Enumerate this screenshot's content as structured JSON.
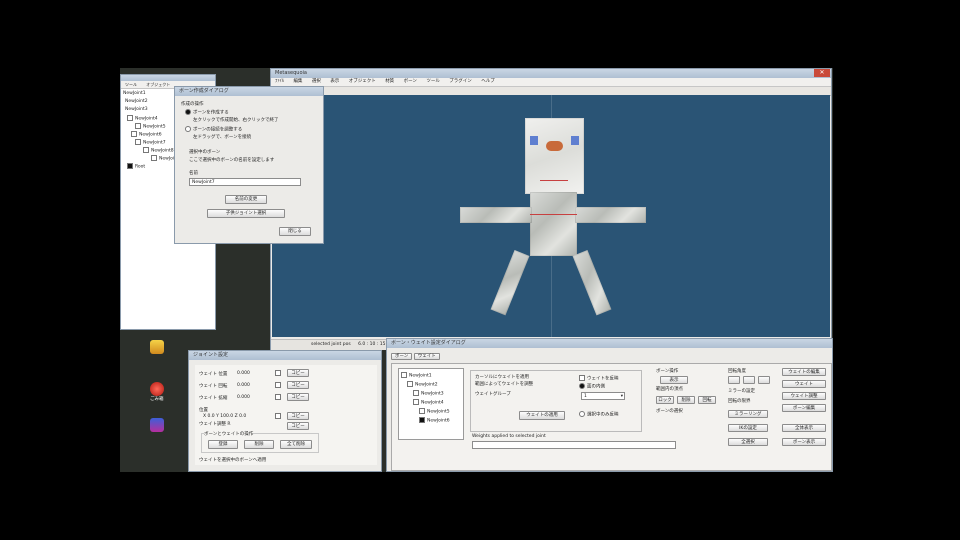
{
  "editor": {
    "title": "Metasequoia",
    "menu": [
      "ﾌｧｲﾙ",
      "編集",
      "選択",
      "表示",
      "オブジェクト",
      "材質",
      "ボーン",
      "ツール",
      "プラグイン",
      "ヘルプ"
    ],
    "status": [
      "selected joint pos",
      "6.0 : 10 : 15"
    ]
  },
  "desktop_icons": [
    "",
    "ごみ箱",
    ""
  ],
  "left_panel": {
    "tabs": [
      "ツール",
      "オブジェクト"
    ],
    "tree": [
      "NewJoint1",
      "NewJoint2",
      "NewJoint3",
      "NewJoint4",
      "NewJoint5",
      "NewJoint6",
      "NewJoint7",
      "NewJoint8",
      "NewJoint9",
      "Root"
    ]
  },
  "bone_dialog": {
    "title": "ボーン作成ダイアログ",
    "group1": "作成の操作",
    "radio1": "ボーンを作成する",
    "radio1_desc": "左クリックで作成開始、右クリックで終了",
    "radio2": "ボーンの接続を調整する",
    "radio2_desc": "左ドラッグで、ボーンを接続",
    "group2": "選択中のボーン",
    "desc2": "ここで選択中のボーンの名前を設定します",
    "name_label": "名前",
    "name_value": "NewJoint7",
    "apply_button": "名前の変更",
    "btn2": "子供ジョイント選択",
    "close_button": "閉じる"
  },
  "joint_dialog": {
    "title": "ジョイント設定",
    "rows": [
      {
        "label": "ウェイト 位置",
        "value": "0.000",
        "btn": "コピー"
      },
      {
        "label": "ウェイト 回転",
        "value": "0.000",
        "btn": "コピー"
      },
      {
        "label": "ウェイト 拡縮",
        "value": "0.000",
        "btn": "コピー"
      }
    ],
    "pos_label": "位置",
    "pos_x": "X 0.0 Y 100.0 Z 0.0",
    "rot_label": "ウェイト調整 R",
    "group": "ボーンとウェイトの操作",
    "btn_a": "登録",
    "btn_b": "削除",
    "btn_c": "全て削除",
    "footer": "ウェイトを選択中のボーンへ適用"
  },
  "weight_panel": {
    "title": "ボーン・ウェイト設定ダイアログ",
    "tabs": [
      "ボーン",
      "ウェイト"
    ],
    "tree": [
      "NewJoint1",
      "NewJoint2",
      "NewJoint3",
      "NewJoint4",
      "NewJoint5",
      "NewJoint6"
    ],
    "group_label": "ウェイトグループ",
    "desc1": "カーソルにウェイトを適用",
    "desc2": "範囲によってウェイトを調整",
    "option1": "ウェイトを反映",
    "option2": "選択中のみ反映",
    "radio_on": "面の内側",
    "radio_off": "ウェイト範囲",
    "dropdown_value": "1",
    "wide_button": "ウェイトの適用",
    "status_text": "Weights applied to selected joint",
    "right_labels": [
      "ボーン操作",
      "範囲内の頂点",
      "ボーンの選択",
      "回転角度",
      "ミラーの設定",
      "回転の限界"
    ],
    "right_buttons": [
      "表示",
      "ロック",
      "削除",
      "回転",
      "ミラーリング",
      "IKの設定",
      "全選択",
      "反転"
    ],
    "far_right": [
      "ウェイトの編集",
      "ウェイト",
      "ウェイト調整",
      "ボーン編集",
      "全体表示",
      "ボーン表示"
    ]
  },
  "colors": {
    "viewport": "#2a5475",
    "block": "#c8cbc6",
    "eye": "#5f7fd0",
    "nose": "#c86a3a",
    "bone_line": "#c74040"
  }
}
